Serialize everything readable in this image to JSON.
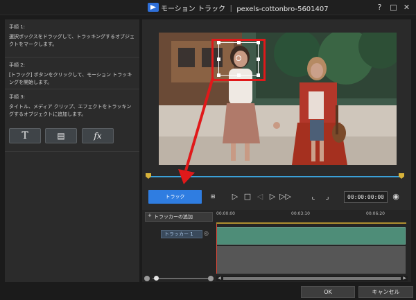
{
  "window": {
    "title": "モーション トラック ｜ pexels-cottonbro-5601407",
    "help": "?",
    "restore": "□",
    "close": "✕"
  },
  "steps": [
    {
      "title": "手順 1:",
      "text": "選択ボックスをドラッグして、トラッキングするオブジェクトをマークします。"
    },
    {
      "title": "手順 2:",
      "text": "[トラック] ボタンをクリックして、モーション トラッキングを開始します。"
    },
    {
      "title": "手順 3:",
      "text": "タイトル、メディア クリップ、エフェクトをトラッキングするオブジェクトに追加します。"
    }
  ],
  "object_buttons": {
    "title": "T",
    "media": "▤",
    "effect": "fx"
  },
  "controls": {
    "track_label": "トラック",
    "timecode": "00:00:00:00"
  },
  "tracker": {
    "add_label": "トラッカーの追加",
    "row_label": "トラッカー 1",
    "ruler_ticks": [
      "00:00:00",
      "00:03:10",
      "00:06:20"
    ]
  },
  "dialog": {
    "ok": "OK",
    "cancel": "キャンセル"
  },
  "colors": {
    "accent": "#2f7de1",
    "highlight_red": "#e0191a",
    "track_green": "#4e8d78"
  }
}
